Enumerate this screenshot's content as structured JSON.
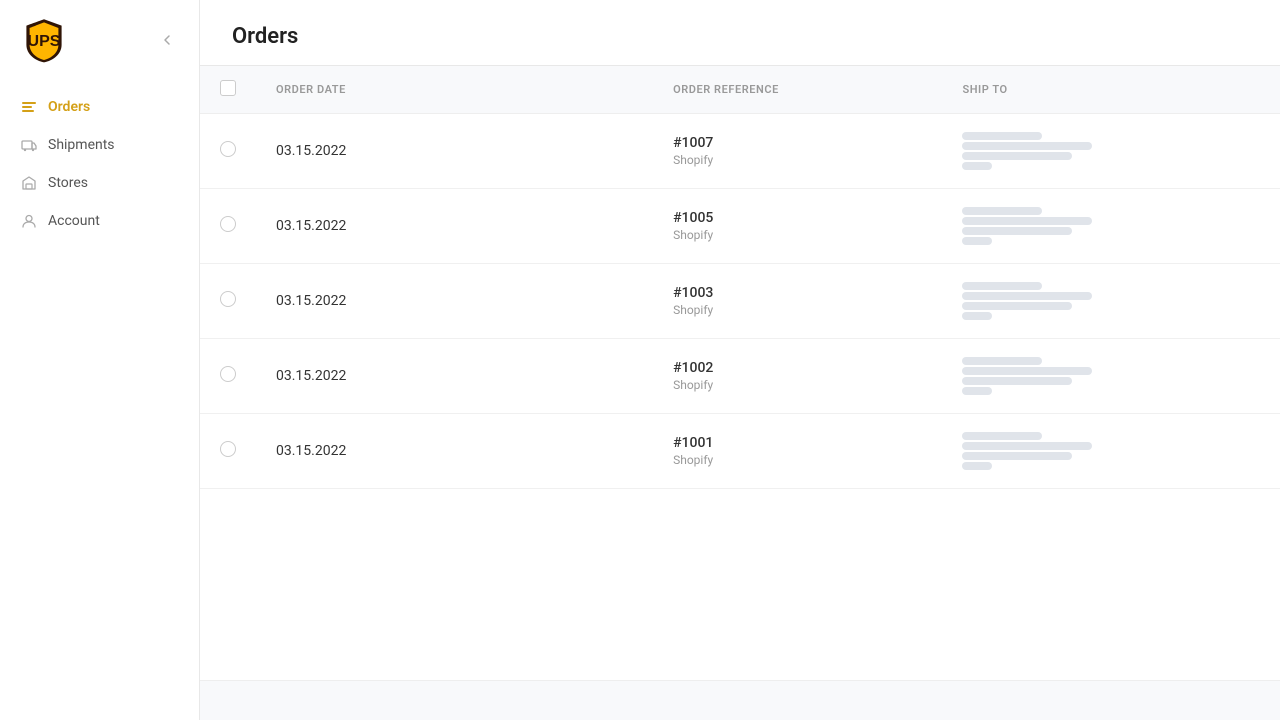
{
  "sidebar": {
    "logo_alt": "UPS Logo",
    "collapse_tooltip": "Collapse sidebar",
    "nav_items": [
      {
        "id": "orders",
        "label": "Orders",
        "active": true,
        "icon": "orders-icon"
      },
      {
        "id": "shipments",
        "label": "Shipments",
        "active": false,
        "icon": "shipments-icon"
      },
      {
        "id": "stores",
        "label": "Stores",
        "active": false,
        "icon": "stores-icon"
      },
      {
        "id": "account",
        "label": "Account",
        "active": false,
        "icon": "account-icon"
      }
    ]
  },
  "page": {
    "title": "Orders"
  },
  "table": {
    "columns": [
      {
        "id": "checkbox",
        "label": ""
      },
      {
        "id": "order_date",
        "label": "ORDER DATE"
      },
      {
        "id": "order_reference",
        "label": "ORDER REFERENCE"
      },
      {
        "id": "ship_to",
        "label": "SHIP TO"
      }
    ],
    "rows": [
      {
        "id": "row1",
        "date": "03.15.2022",
        "ref": "#1007",
        "source": "Shopify"
      },
      {
        "id": "row2",
        "date": "03.15.2022",
        "ref": "#1005",
        "source": "Shopify"
      },
      {
        "id": "row3",
        "date": "03.15.2022",
        "ref": "#1003",
        "source": "Shopify"
      },
      {
        "id": "row4",
        "date": "03.15.2022",
        "ref": "#1002",
        "source": "Shopify"
      },
      {
        "id": "row5",
        "date": "03.15.2022",
        "ref": "#1001",
        "source": "Shopify"
      }
    ]
  }
}
